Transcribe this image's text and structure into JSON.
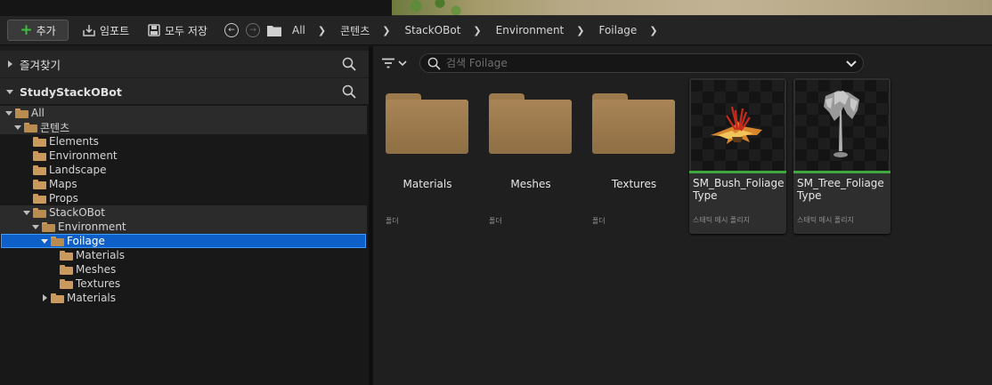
{
  "toolbar": {
    "add_label": "추가",
    "import_label": "임포트",
    "save_all_label": "모두 저장"
  },
  "breadcrumb": [
    "All",
    "콘텐츠",
    "StackOBot",
    "Environment",
    "Foilage"
  ],
  "favorites": {
    "title": "즐겨찾기"
  },
  "project": {
    "title": "StudyStackOBot"
  },
  "tree": [
    {
      "label": "All"
    },
    {
      "label": "콘텐츠"
    },
    {
      "label": "Elements"
    },
    {
      "label": "Environment"
    },
    {
      "label": "Landscape"
    },
    {
      "label": "Maps"
    },
    {
      "label": "Props"
    },
    {
      "label": "StackOBot"
    },
    {
      "label": "Environment"
    },
    {
      "label": "Foilage"
    },
    {
      "label": "Materials"
    },
    {
      "label": "Meshes"
    },
    {
      "label": "Textures"
    },
    {
      "label": "Materials"
    }
  ],
  "search": {
    "placeholder": "검색 Foilage"
  },
  "assets": [
    {
      "name": "Materials",
      "type": "폴더"
    },
    {
      "name": "Meshes",
      "type": "폴더"
    },
    {
      "name": "Textures",
      "type": "폴더"
    },
    {
      "name": "SM_Bush_Foliage Type",
      "type": "스태틱 메시 폴리지"
    },
    {
      "name": "SM_Tree_Foliage Type",
      "type": "스태틱 메시 폴리지"
    }
  ],
  "colors": {
    "selection": "#0f5fc9",
    "folder": "#c99a5b",
    "asset_bar": "#3fa83f",
    "add_plus": "#3fbf3f"
  }
}
